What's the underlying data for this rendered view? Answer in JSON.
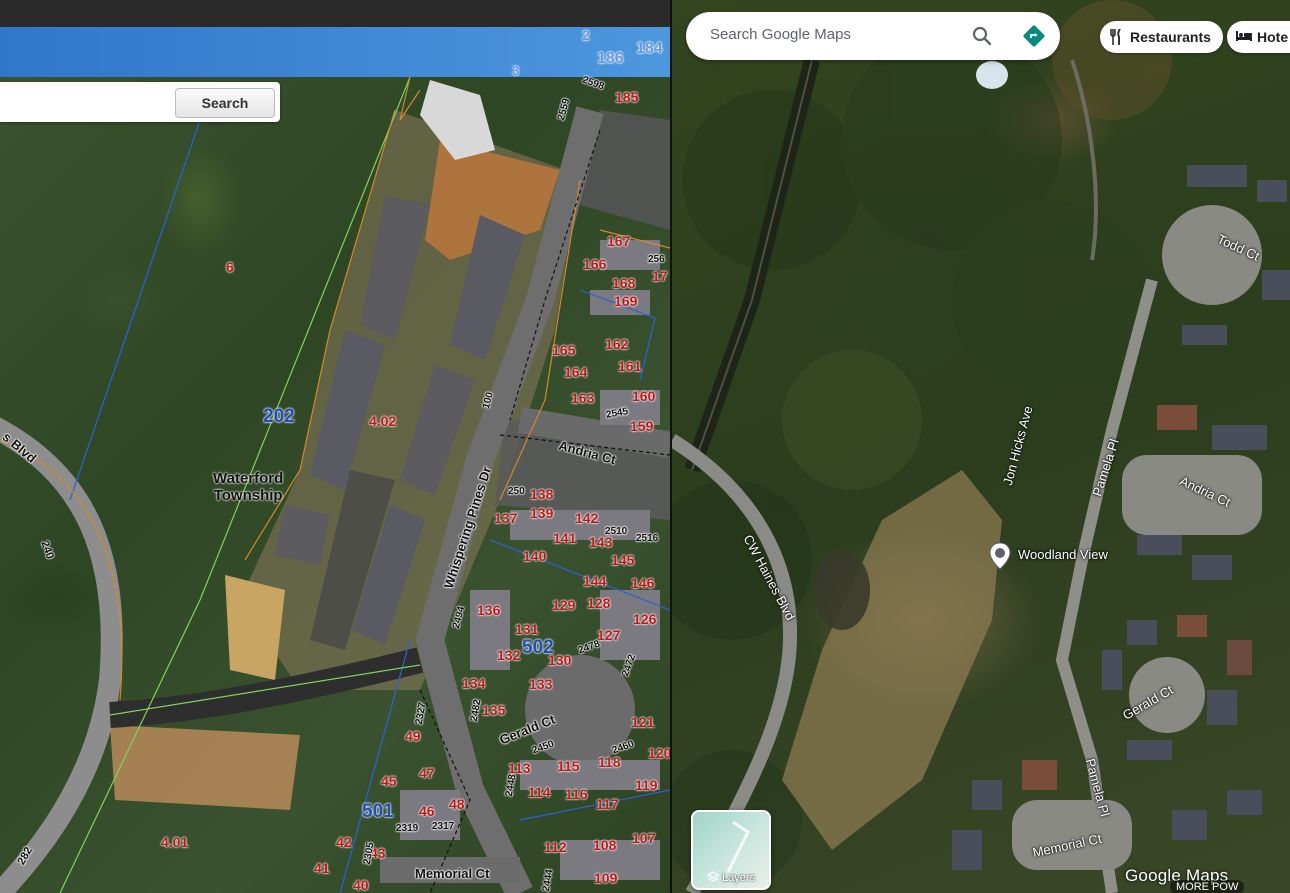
{
  "gis": {
    "search_button": "Search",
    "districts": [
      "202",
      "502",
      "501"
    ],
    "township_line1": "Waterford",
    "township_line2": "Township",
    "parcels": [
      "6",
      "4.02",
      "4.01",
      "185",
      "167",
      "166",
      "168",
      "169",
      "17",
      "162",
      "161",
      "165",
      "164",
      "163",
      "160",
      "159",
      "138",
      "137",
      "139",
      "142",
      "141",
      "143",
      "140",
      "145",
      "144",
      "146",
      "136",
      "129",
      "128",
      "126",
      "131",
      "127",
      "132",
      "130",
      "134",
      "133",
      "135",
      "121",
      "120",
      "113",
      "115",
      "118",
      "114",
      "116",
      "117",
      "119",
      "107",
      "108",
      "112",
      "109",
      "49",
      "45",
      "47",
      "46",
      "48",
      "42",
      "43",
      "41",
      "40",
      "186",
      "184",
      "2",
      "3"
    ],
    "streets": {
      "andria": "Andria Ct",
      "whispering": "Whispering Pines Dr",
      "gerald": "Gerald Ct",
      "memorial": "Memorial Ct",
      "haines_partial": "s Blvd"
    },
    "address_numbers": [
      "2598",
      "2559",
      "100",
      "2545",
      "250",
      "2510",
      "2516",
      "2494",
      "2478",
      "2472",
      "2482",
      "2450",
      "2460",
      "2448",
      "2327",
      "2319",
      "2317",
      "2305",
      "2444",
      "240",
      "282",
      "256"
    ]
  },
  "gmaps": {
    "search_placeholder": "Search Google Maps",
    "chips": [
      {
        "label": "Restaurants",
        "icon": "fork-knife-icon"
      },
      {
        "label": "Hote",
        "icon": "bed-icon"
      }
    ],
    "layers_label": "Layers",
    "place_name": "Woodland View",
    "streets": {
      "todd": "Todd Ct",
      "jon_hicks": "Jon Hicks Ave",
      "pamela_top": "Pamela Pl",
      "andria": "Andria Ct",
      "cw_haines": "CW Haines Blvd",
      "gerald": "Gerald Ct",
      "pamela_bottom": "Pamela Pl",
      "memorial": "Memorial Ct"
    },
    "logo_google": "Google",
    "logo_maps": "Maps",
    "powered": "MORE POW"
  },
  "colors": {
    "banner_blue": "#3a86d4",
    "parcel_red": "#c01818",
    "district_blue": "#1f4fb8",
    "directions_teal": "#0b8a7c"
  }
}
